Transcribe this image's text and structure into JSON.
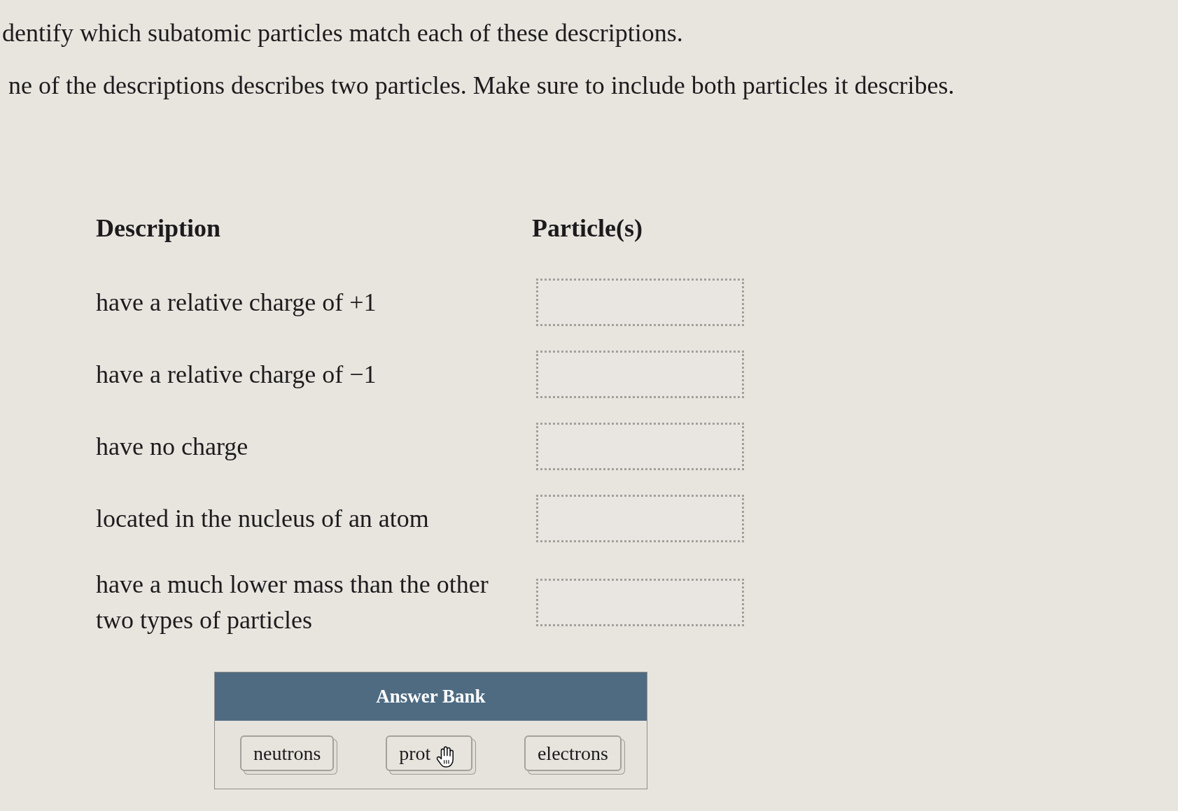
{
  "instructions": [
    "dentify which subatomic particles match each of these descriptions.",
    "ne of the descriptions describes two particles. Make sure to include both particles it describes."
  ],
  "table": {
    "columns": [
      "Description",
      "Particle(s)"
    ],
    "rows": [
      {
        "description": "have a relative charge of +1"
      },
      {
        "description": "have a relative charge of −1"
      },
      {
        "description": "have no charge"
      },
      {
        "description": "located in the nucleus of an atom"
      },
      {
        "description": "have a much lower mass than the other two types of particles"
      }
    ]
  },
  "answer_bank": {
    "title": "Answer Bank",
    "items": [
      {
        "label": "neutrons",
        "hovered": false
      },
      {
        "label": "prot",
        "hovered": true
      },
      {
        "label": "electrons",
        "hovered": false
      }
    ]
  }
}
